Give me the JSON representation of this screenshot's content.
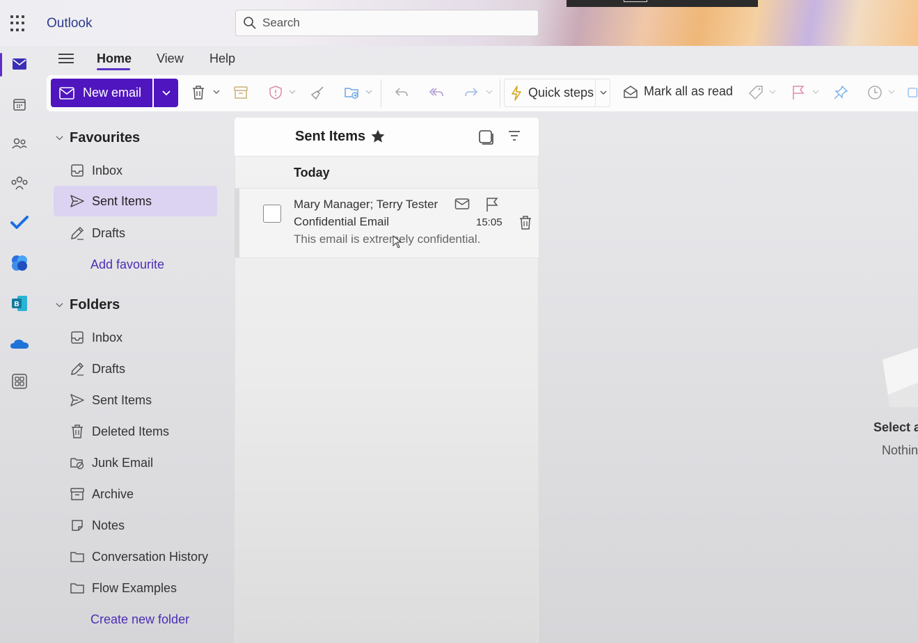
{
  "app": {
    "name": "Outlook"
  },
  "search": {
    "placeholder": "Search"
  },
  "menu": {
    "tabs": [
      "Home",
      "View",
      "Help"
    ],
    "active": "Home"
  },
  "ribbon": {
    "new_email_label": "New email",
    "quick_steps_label": "Quick steps",
    "mark_all_read_label": "Mark all as read"
  },
  "favourites": {
    "heading": "Favourites",
    "items": [
      {
        "label": "Inbox",
        "icon": "inbox-icon"
      },
      {
        "label": "Sent Items",
        "icon": "send-icon",
        "selected": true
      },
      {
        "label": "Drafts",
        "icon": "pencil-icon"
      }
    ],
    "add_link": "Add favourite"
  },
  "folders": {
    "heading": "Folders",
    "items": [
      {
        "label": "Inbox",
        "icon": "inbox-icon"
      },
      {
        "label": "Drafts",
        "icon": "pencil-icon"
      },
      {
        "label": "Sent Items",
        "icon": "send-icon"
      },
      {
        "label": "Deleted Items",
        "icon": "trash-icon"
      },
      {
        "label": "Junk Email",
        "icon": "junk-icon"
      },
      {
        "label": "Archive",
        "icon": "archive-icon"
      },
      {
        "label": "Notes",
        "icon": "note-icon"
      },
      {
        "label": "Conversation History",
        "icon": "folder-icon"
      },
      {
        "label": "Flow Examples",
        "icon": "folder-icon"
      }
    ],
    "create_link": "Create new folder"
  },
  "message_list": {
    "title": "Sent Items",
    "group": "Today",
    "messages": [
      {
        "from": "Mary Manager; Terry Tester",
        "subject": "Confidential Email",
        "preview": "This email is extremely confidential.",
        "time": "15:05"
      }
    ]
  },
  "reading_pane": {
    "title": "Select ar",
    "subtitle": "Nothin"
  },
  "colors": {
    "accent": "#4f16bf",
    "selected_bg": "#dcd3f2",
    "link": "#4c2db3"
  }
}
